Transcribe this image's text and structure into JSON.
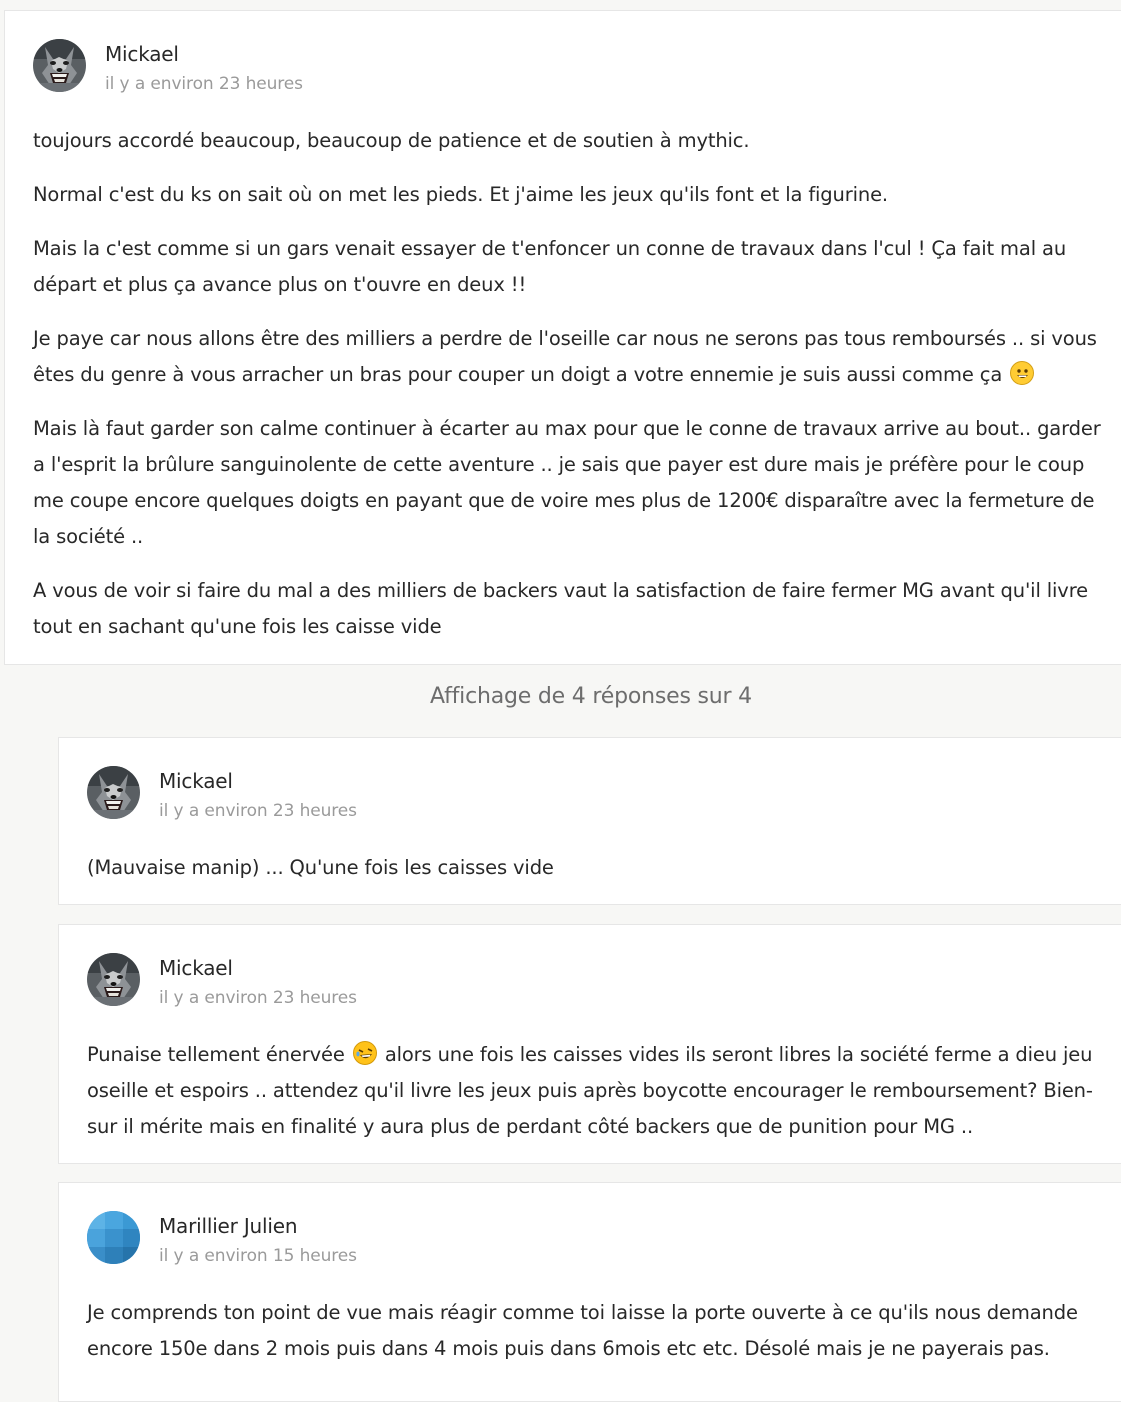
{
  "main_comment": {
    "author": "Mickael",
    "timestamp": "il y a environ 23 heures",
    "avatar_icon": "wolf-avatar-icon",
    "paragraphs": [
      "toujours accordé beaucoup, beaucoup de patience et de soutien à mythic.",
      "Normal c'est du ks on sait où on met les pieds. Et j'aime les jeux qu'ils font et la figurine.",
      "Mais la c'est comme si un gars venait essayer de t'enfoncer un conne de travaux dans l'cul ! Ça fait mal au départ et plus ça avance plus on t'ouvre en deux !!",
      "Je paye car nous allons être des milliers a perdre de l'oseille car nous ne serons pas tous remboursés .. si vous êtes du genre à vous arracher un bras pour couper un doigt a votre ennemie je suis aussi comme ça",
      "Mais là faut garder son calme continuer à écarter au max pour que le conne de travaux arrive au bout.. garder a l'esprit la brûlure sanguinolente de cette aventure .. je sais que payer est dure mais je préfère pour le coup me coupe encore quelques doigts en payant que de voire mes plus de 1200€ disparaître avec la fermeture de la société ..",
      "A vous de voir si faire du mal a des milliers de backers vaut la satisfaction de faire fermer MG avant qu'il livre tout en sachant qu'une fois les caisse vide"
    ]
  },
  "replies_summary": "Affichage de 4 réponses sur 4",
  "replies": [
    {
      "author": "Mickael",
      "timestamp": "il y a environ 23 heures",
      "avatar_icon": "wolf-avatar-icon",
      "paragraphs": [
        "(Mauvaise manip) ... Qu'une fois les caisses vide"
      ]
    },
    {
      "author": "Mickael",
      "timestamp": "il y a environ 23 heures",
      "avatar_icon": "wolf-avatar-icon",
      "paragraphs": [
        "Punaise tellement énervée",
        "alors une fois les caisses vides ils seront libres la société ferme a dieu jeu oseille et espoirs .. attendez qu'il livre les jeux puis après boycotte encourager le remboursement? Bien-sur il mérite mais en finalité y aura plus de perdant côté backers que de punition pour MG .."
      ]
    },
    {
      "author": "Marillier Julien",
      "timestamp": "il y a environ 15 heures",
      "avatar_icon": "blue-mosaic-avatar-icon",
      "paragraphs": [
        "Je comprends ton point de vue mais réagir comme toi laisse la porte ouverte à ce qu'ils nous demande encore 150e dans 2 mois puis dans 4 mois puis dans 6mois etc etc. Désolé mais je ne payerais pas."
      ]
    }
  ],
  "colors": {
    "page_background": "#f7f7f5",
    "card_background": "#ffffff",
    "text": "#282828",
    "muted_text": "#9a9a9a",
    "replies_summary_text": "#6d6d6d"
  }
}
